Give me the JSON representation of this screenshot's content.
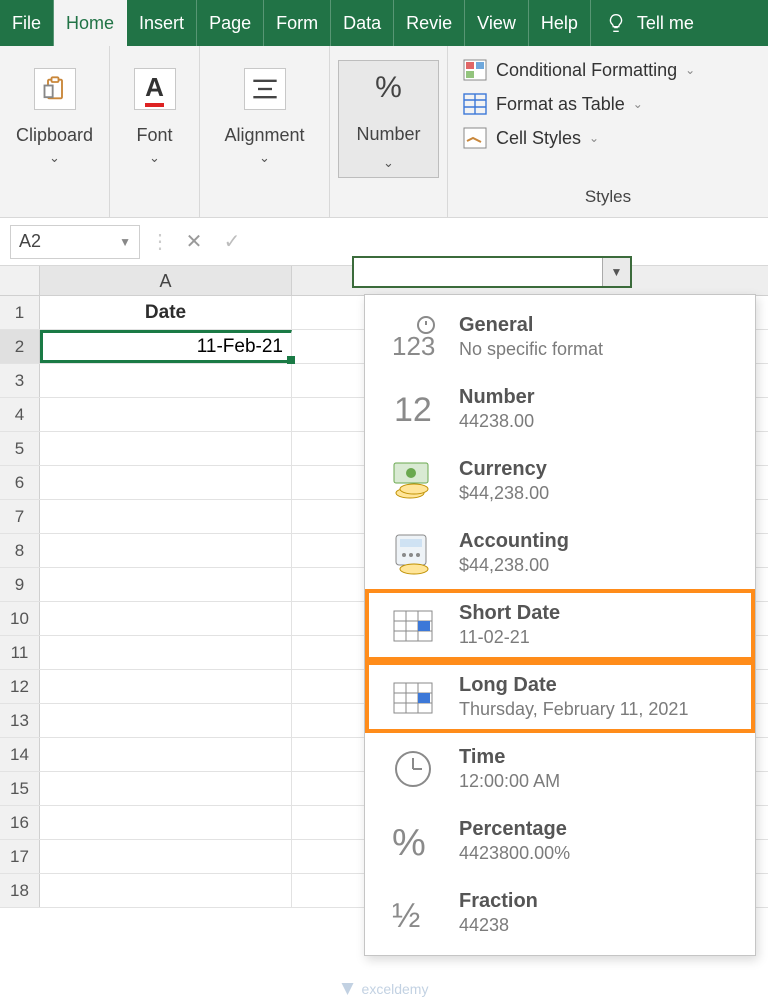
{
  "tabs": [
    "File",
    "Home",
    "Insert",
    "Page",
    "Form",
    "Data",
    "Revie",
    "View",
    "Help"
  ],
  "active_tab_index": 1,
  "tellme": "Tell me",
  "ribbon": {
    "clipboard": "Clipboard",
    "font": "Font",
    "alignment": "Alignment",
    "number": "Number",
    "number_icon": "%",
    "styles_label": "Styles",
    "cond_fmt": "Conditional Formatting",
    "fmt_table": "Format as Table",
    "cell_styles": "Cell Styles"
  },
  "namebox": "A2",
  "sheet": {
    "col_label": "A",
    "row_numbers": [
      "1",
      "2",
      "3",
      "4",
      "5",
      "6",
      "7",
      "8",
      "9",
      "10",
      "11",
      "12",
      "13",
      "14",
      "15",
      "16",
      "17",
      "18"
    ],
    "header_cell": "Date",
    "selected_value": "11-Feb-21"
  },
  "format_box_value": "",
  "formats": [
    {
      "title": "General",
      "sub": "No specific format",
      "icon": "general"
    },
    {
      "title": "Number",
      "sub": "44238.00",
      "icon": "number"
    },
    {
      "title": "Currency",
      "sub": "$44,238.00",
      "icon": "currency"
    },
    {
      "title": "Accounting",
      "sub": " $44,238.00",
      "icon": "accounting"
    },
    {
      "title": "Short Date",
      "sub": "11-02-21",
      "icon": "calendar",
      "highlight": true
    },
    {
      "title": "Long Date",
      "sub": "Thursday, February 11, 2021",
      "icon": "calendar",
      "highlight": true
    },
    {
      "title": "Time",
      "sub": "12:00:00 AM",
      "icon": "time"
    },
    {
      "title": "Percentage",
      "sub": "4423800.00%",
      "icon": "percent"
    },
    {
      "title": "Fraction",
      "sub": "44238",
      "icon": "fraction"
    }
  ],
  "watermark": "exceldemy"
}
